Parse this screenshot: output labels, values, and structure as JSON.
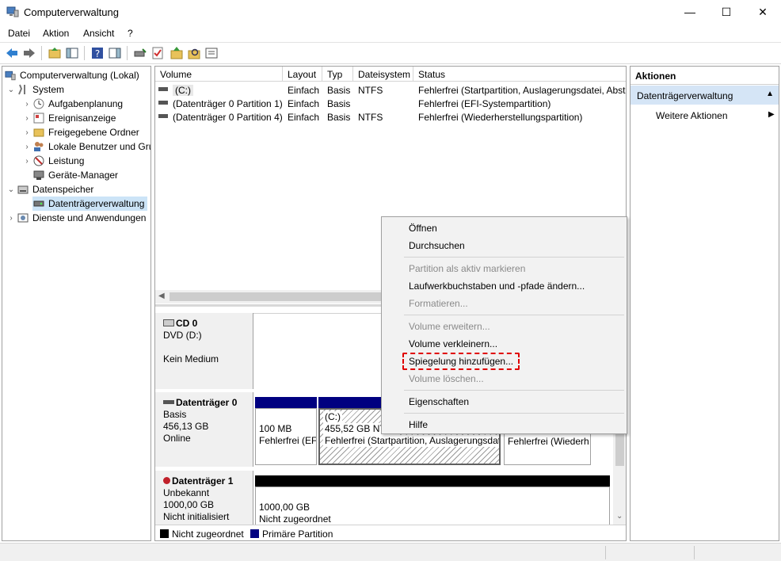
{
  "window": {
    "title": "Computerverwaltung",
    "minimize": "—",
    "maximize": "☐",
    "close": "✕"
  },
  "menu": [
    "Datei",
    "Aktion",
    "Ansicht",
    "?"
  ],
  "tree": {
    "root": "Computerverwaltung (Lokal)",
    "system": "System",
    "aufgabenplanung": "Aufgabenplanung",
    "ereignisanzeige": "Ereignisanzeige",
    "freigegebene": "Freigegebene Ordner",
    "benutzer": "Lokale Benutzer und Gruppen",
    "leistung": "Leistung",
    "geraete": "Geräte-Manager",
    "datenspeicher": "Datenspeicher",
    "datentraeger": "Datenträgerverwaltung",
    "dienste": "Dienste und Anwendungen"
  },
  "volumes": {
    "headers": [
      "Volume",
      "Layout",
      "Typ",
      "Dateisystem",
      "Status"
    ],
    "rows": [
      [
        "(C:)",
        "Einfach",
        "Basis",
        "NTFS",
        "Fehlerfrei (Startpartition, Auslagerungsdatei, Absturz"
      ],
      [
        "(Datenträger 0 Partition 1)",
        "Einfach",
        "Basis",
        "",
        "Fehlerfrei (EFI-Systempartition)"
      ],
      [
        "(Datenträger 0 Partition 4)",
        "Einfach",
        "Basis",
        "NTFS",
        "Fehlerfrei (Wiederherstellungspartition)"
      ]
    ]
  },
  "disks": {
    "cd0": {
      "name": "CD 0",
      "type": "DVD (D:)",
      "media": "Kein Medium"
    },
    "disk0": {
      "name": "Datenträger 0",
      "type": "Basis",
      "size": "456,13 GB",
      "state": "Online",
      "p1_size": "100 MB",
      "p1_status": "Fehlerfrei (EFI",
      "p2_name": "(C:)",
      "p2_size": "455,52 GB NTFS",
      "p2_status": "Fehlerfrei (Startpartition, Auslagerungsdatei",
      "p4_status": "Fehlerfrei (Wiederh"
    },
    "disk1": {
      "name": "Datenträger 1",
      "type": "Unbekannt",
      "size": "1000,00 GB",
      "state": "Nicht initialisiert",
      "p_size": "1000,00 GB",
      "p_status": "Nicht zugeordnet"
    }
  },
  "legend": {
    "unallocated": "Nicht zugeordnet",
    "primary": "Primäre Partition"
  },
  "actions": {
    "header": "Aktionen",
    "selected": "Datenträgerverwaltung",
    "more": "Weitere Aktionen"
  },
  "context_menu": {
    "open": "Öffnen",
    "explore": "Durchsuchen",
    "mark_active": "Partition als aktiv markieren",
    "change_letter": "Laufwerkbuchstaben und -pfade ändern...",
    "format": "Formatieren...",
    "extend": "Volume erweitern...",
    "shrink": "Volume verkleinern...",
    "add_mirror": "Spiegelung hinzufügen...",
    "delete": "Volume löschen...",
    "properties": "Eigenschaften",
    "help": "Hilfe"
  },
  "colors": {
    "primary_partition": "#000080",
    "unallocated": "#000000",
    "selection": "#d5e5f6",
    "highlight": "#e00000"
  }
}
